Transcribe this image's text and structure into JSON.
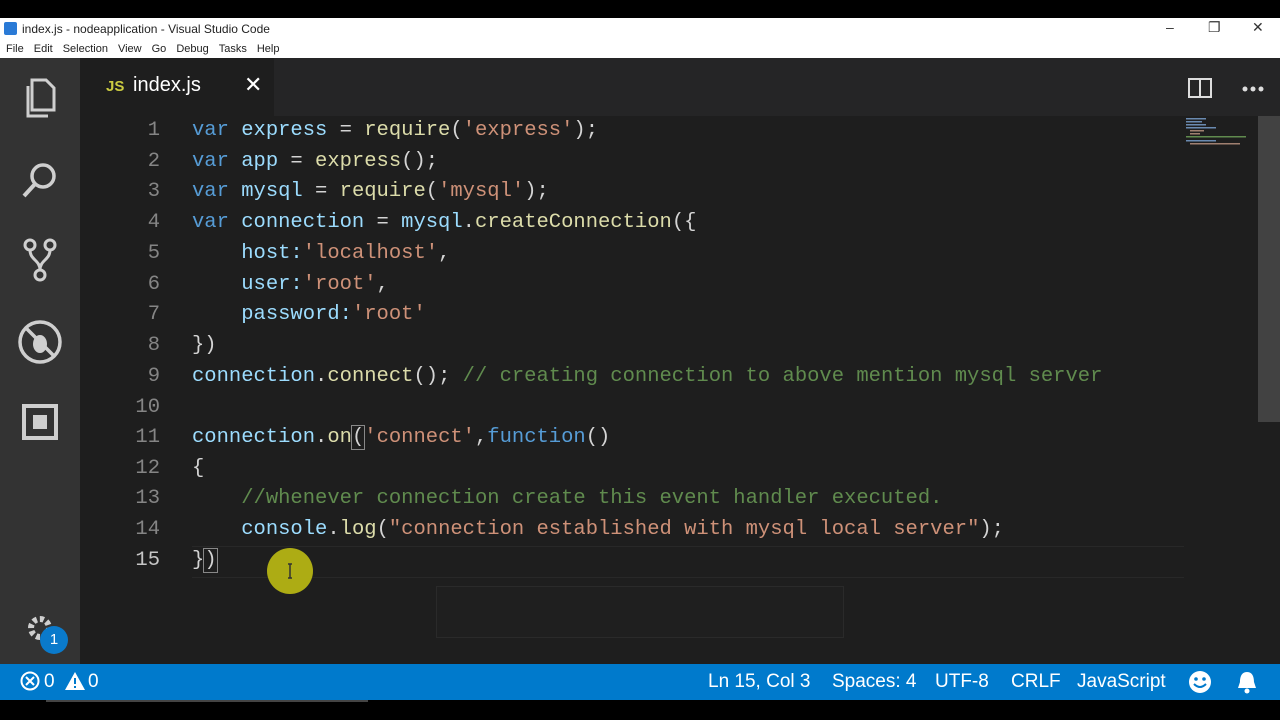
{
  "window": {
    "title": "index.js - nodeapplication - Visual Studio Code",
    "minimize": "–",
    "restore": "❐",
    "close": "✕"
  },
  "menu": [
    "File",
    "Edit",
    "Selection",
    "View",
    "Go",
    "Debug",
    "Tasks",
    "Help"
  ],
  "activity_badge": "1",
  "tab": {
    "icon_text": "JS",
    "name": "index.js",
    "close": "✕"
  },
  "line_numbers": [
    "1",
    "2",
    "3",
    "4",
    "5",
    "6",
    "7",
    "8",
    "9",
    "10",
    "11",
    "12",
    "13",
    "14",
    "15"
  ],
  "status": {
    "errors": "0",
    "warnings": "0",
    "position": "Ln 15, Col 3",
    "spaces": "Spaces: 4",
    "encoding": "UTF-8",
    "eol": "CRLF",
    "language": "JavaScript"
  },
  "colors": {
    "statusbar": "#007acc",
    "editor_bg": "#1e1e1e",
    "activity_bg": "#333333",
    "keyword": "#569cd6",
    "string": "#ce9178",
    "comment": "#608b4e",
    "function": "#dcdcaa",
    "variable": "#9cdcfe"
  },
  "code": {
    "l1": {
      "k": "var",
      "v": "express",
      "eq": " = ",
      "f": "require",
      "p1": "(",
      "s": "'express'",
      "p2": ");"
    },
    "l2": {
      "k": "var",
      "v": "app",
      "eq": " = ",
      "f": "express",
      "p": "();"
    },
    "l3": {
      "k": "var",
      "v": "mysql",
      "eq": " = ",
      "f": "require",
      "p1": "(",
      "s": "'mysql'",
      "p2": ");"
    },
    "l4": {
      "k": "var",
      "v": "connection",
      "eq": " = ",
      "o": "mysql",
      "dot": ".",
      "f": "createConnection",
      "p": "({"
    },
    "l5": {
      "prop": "host:",
      "s": "'localhost'",
      "p": ","
    },
    "l6": {
      "prop": "user:",
      "s": "'root'",
      "p": ","
    },
    "l7": {
      "prop": "password:",
      "s": "'root'"
    },
    "l8": {
      "p": "})"
    },
    "l9": {
      "o": "connection",
      "dot": ".",
      "f": "connect",
      "p": "();",
      "c": " // creating connection to above mention mysql server"
    },
    "l11": {
      "o": "connection",
      "dot": ".",
      "f": "on",
      "p1": "(",
      "s": "'connect'",
      "p2": ",",
      "k": "function",
      "p3": "()"
    },
    "l12": {
      "p": "{"
    },
    "l13": {
      "c": "//whenever connection create this event handler executed."
    },
    "l14": {
      "o": "console",
      "dot": ".",
      "f": "log",
      "p1": "(",
      "s": "\"connection established with mysql local server\"",
      "p2": ");"
    },
    "l15": {
      "p1": "}",
      "p2": ")"
    }
  }
}
